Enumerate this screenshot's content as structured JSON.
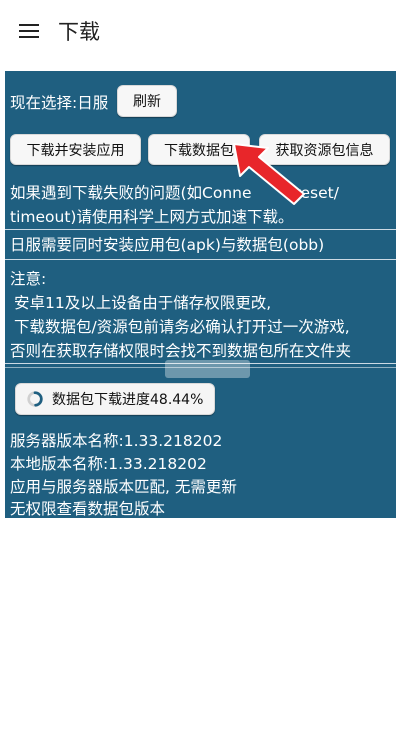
{
  "appbar": {
    "title": "下载",
    "menu_icon": "menu-icon"
  },
  "selection": {
    "label": "现在选择:日服",
    "refresh_label": "刷新"
  },
  "actions": {
    "install_app": "下载并安装应用",
    "download_data": "下载数据包",
    "resource_info": "获取资源包信息"
  },
  "notice": {
    "line1_a": "如果遇到下载失败的问题(如Conne",
    "line1_b": " reset/",
    "line2": "timeout)请使用科学上网方式加速下载。"
  },
  "jp_note": "日服需要同时安装应用包(apk)与数据包(obb)",
  "attention": {
    "title": "注意:",
    "line1": "安卓11及以上设备由于储存权限更改,",
    "line2": "下载数据包/资源包前请务必确认打开过一次游戏,",
    "line3": "否则在获取存储权限时会找不到数据包所在文件夹"
  },
  "progress": {
    "label": "数据包下载进度48.44%",
    "percent": 48.44
  },
  "version": {
    "server": "服务器版本名称:1.33.218202",
    "local": "本地版本名称:1.33.218202",
    "match": "应用与服务器版本匹配, 无需更新",
    "no_perm": "无权限查看数据包版本"
  },
  "colors": {
    "panel": "#1f5f80",
    "arrow": "#e8262a"
  }
}
